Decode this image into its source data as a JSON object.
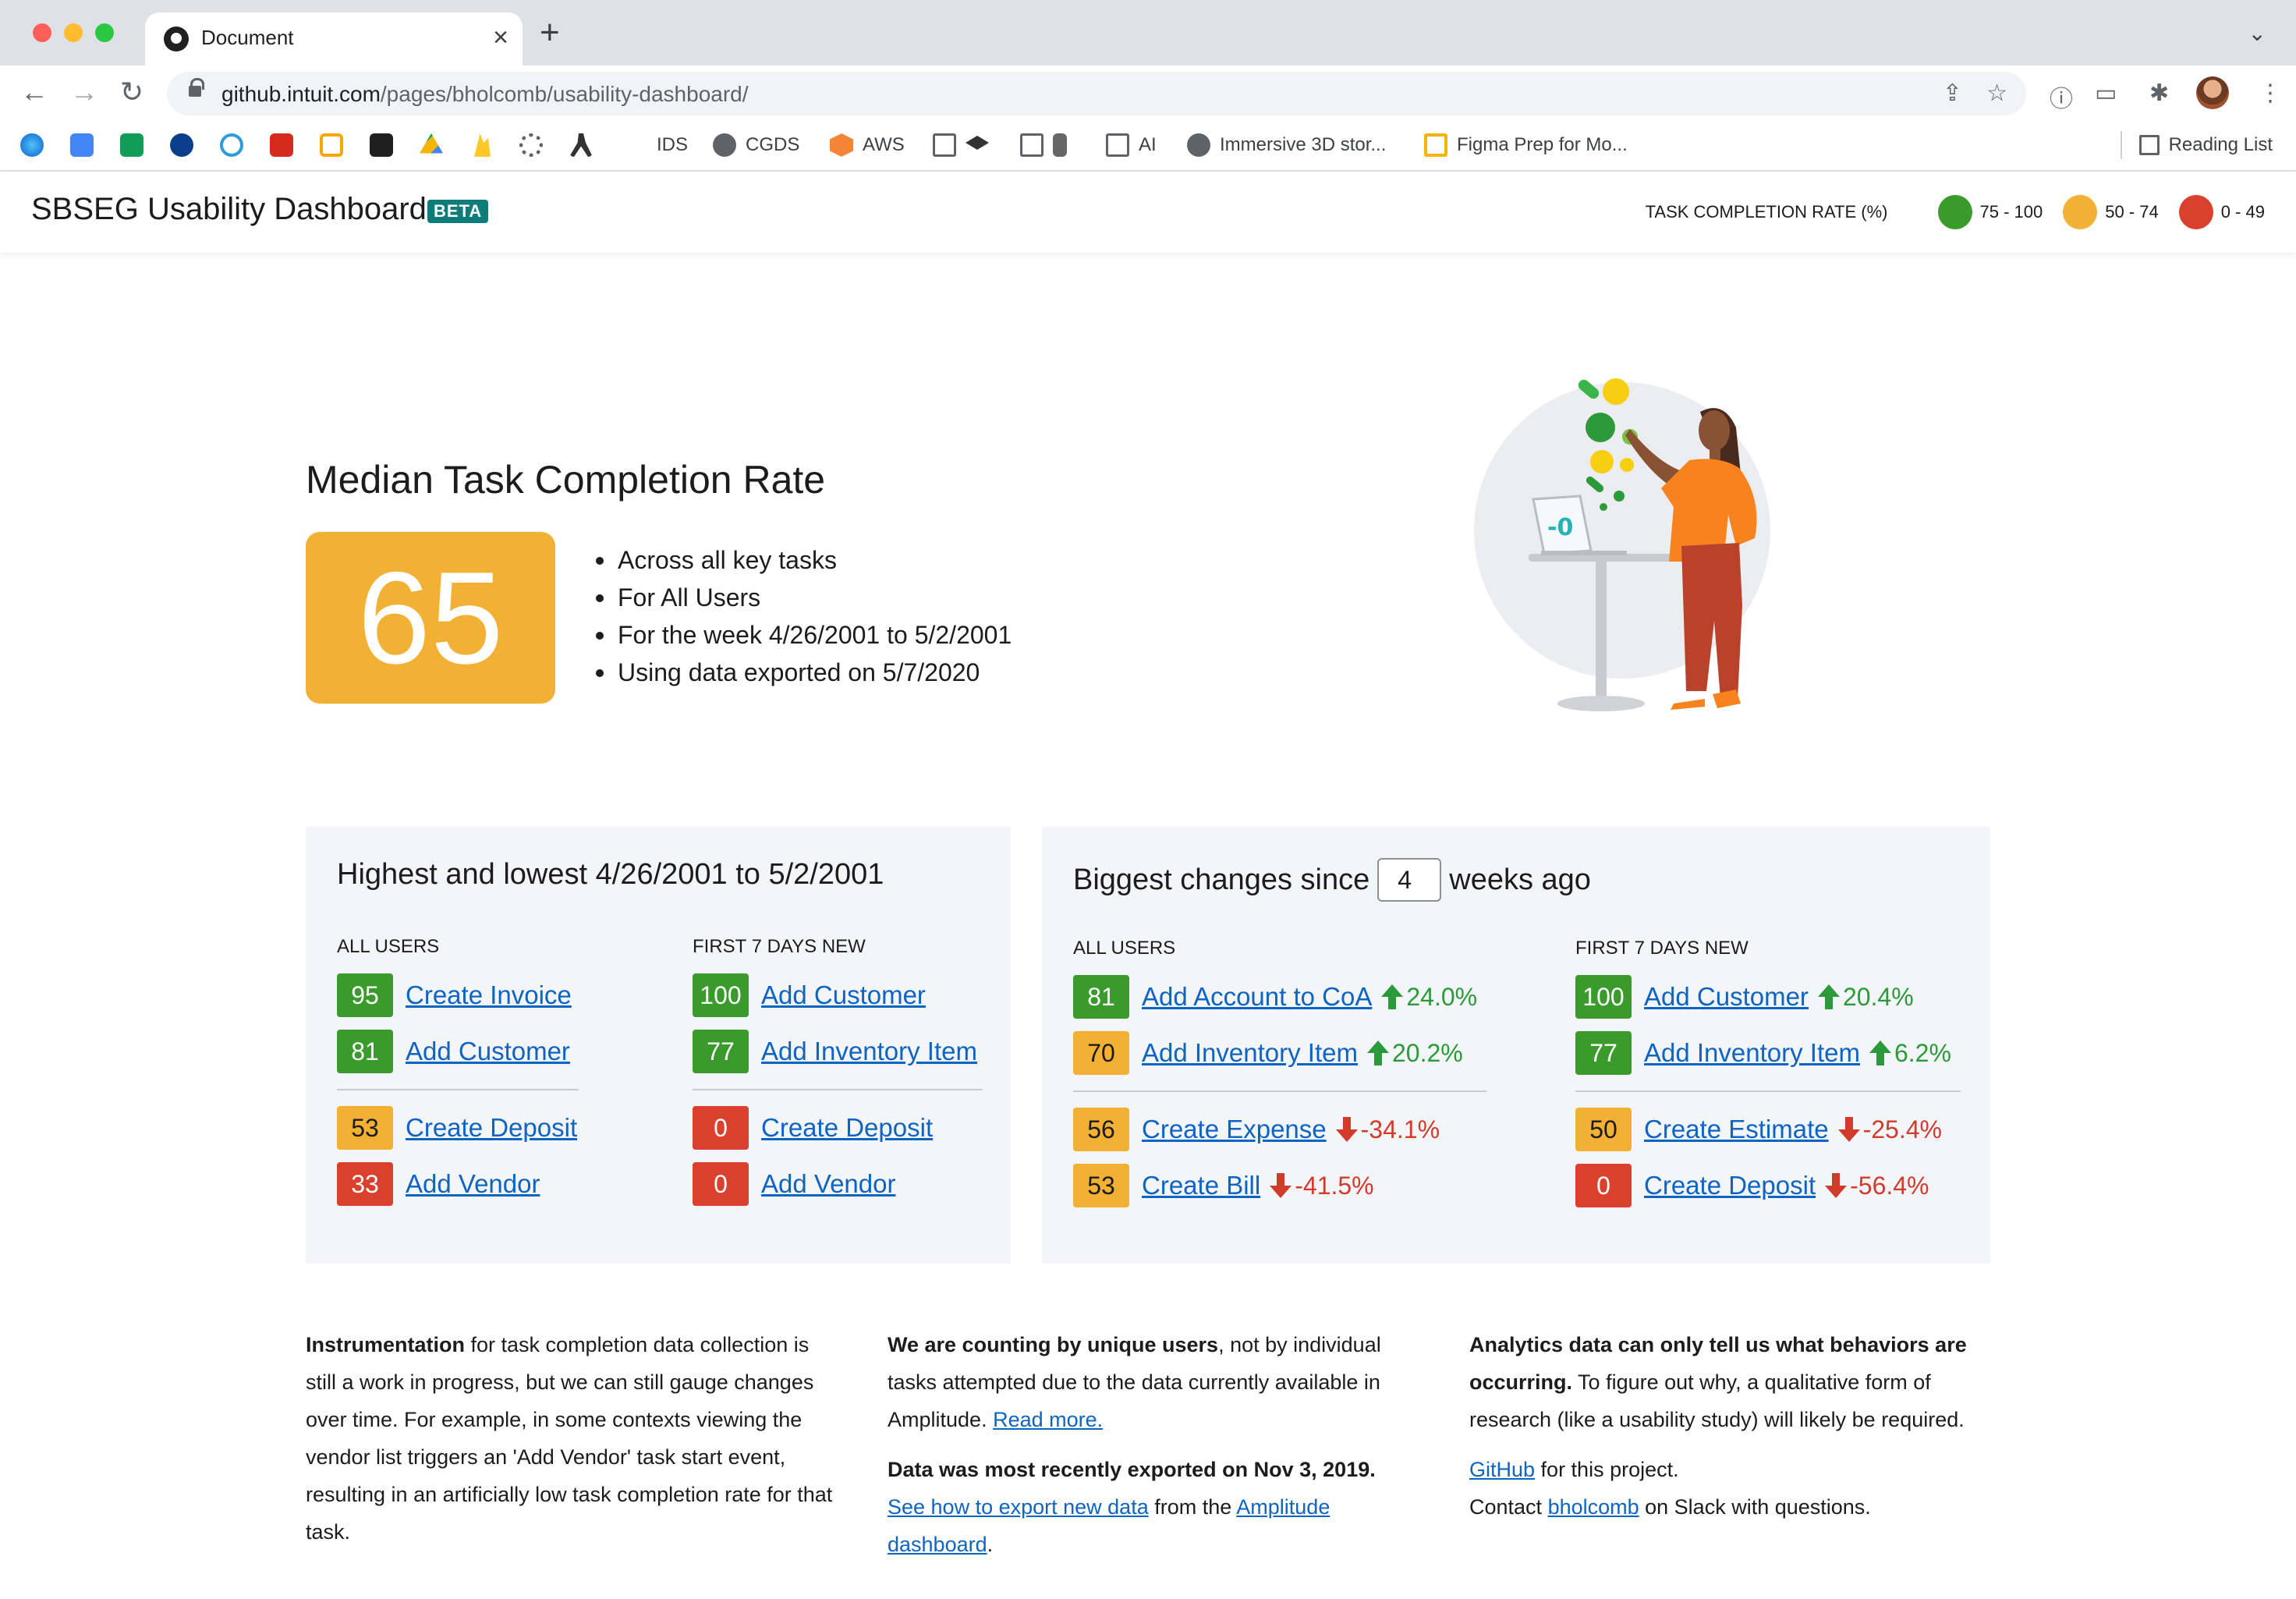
{
  "browser": {
    "tab_title": "Document",
    "tab_close": "×",
    "new_tab": "+",
    "url_host": "github.intuit.com",
    "url_path": "/pages/bholcomb/usability-dashboard/",
    "bookmarks": [
      {
        "label": "IDS",
        "icon": "text-only",
        "color": "#000000"
      },
      {
        "label": "CGDS",
        "icon": "globe-icon",
        "color": "#5f6368"
      },
      {
        "label": "AWS",
        "icon": "cube-icon",
        "color": "#f58534"
      },
      {
        "label": "",
        "icon": "folder-icon",
        "color": "#5f6368"
      },
      {
        "label": "",
        "icon": "folder-icon",
        "color": "#5f6368"
      },
      {
        "label": "AI",
        "icon": "folder-icon",
        "color": "#5f6368"
      },
      {
        "label": "Immersive 3D stor...",
        "icon": "globe-icon",
        "color": "#5f6368"
      },
      {
        "label": "Figma Prep for Mo...",
        "icon": "slides-icon",
        "color": "#f4b400"
      }
    ],
    "reading_list": "Reading List"
  },
  "header": {
    "title": "SBSEG Usability Dashboard",
    "badge": "BETA",
    "legend_title": "TASK COMPLETION RATE (%)",
    "legend": [
      {
        "range": "75 - 100",
        "color": "#3a9a2c"
      },
      {
        "range": "50 - 74",
        "color": "#f2b135"
      },
      {
        "range": "0 - 49",
        "color": "#d9402e"
      }
    ]
  },
  "hero": {
    "title": "Median Task Completion Rate",
    "score": "65",
    "bullets": [
      "Across all key tasks",
      "For All Users",
      "For the week 4/26/2001 to 5/2/2001",
      "Using data exported on 5/7/2020"
    ]
  },
  "highest_lowest": {
    "title": "Highest and lowest 4/26/2001 to 5/2/2001",
    "all_users": {
      "heading": "ALL USERS",
      "top": [
        {
          "score": "95",
          "task": "Create Invoice",
          "color": "#3a9a2c"
        },
        {
          "score": "81",
          "task": "Add Customer",
          "color": "#3a9a2c"
        }
      ],
      "bottom": [
        {
          "score": "53",
          "task": "Create Deposit",
          "color": "#f2b135"
        },
        {
          "score": "33",
          "task": "Add Vendor",
          "color": "#d9402e"
        }
      ]
    },
    "first_7_days": {
      "heading": "FIRST 7 DAYS NEW",
      "top": [
        {
          "score": "100",
          "task": "Add Customer",
          "color": "#3a9a2c"
        },
        {
          "score": "77",
          "task": "Add Inventory Item",
          "color": "#3a9a2c"
        }
      ],
      "bottom": [
        {
          "score": "0",
          "task": "Create Deposit",
          "color": "#d9402e"
        },
        {
          "score": "0",
          "task": "Add Vendor",
          "color": "#d9402e"
        }
      ]
    }
  },
  "biggest_changes": {
    "title_prefix": "Biggest changes since",
    "weeks": "4",
    "title_suffix": "weeks ago",
    "all_users": {
      "heading": "ALL USERS",
      "top": [
        {
          "score": "81",
          "task": "Add Account to CoA",
          "delta": "24.0%",
          "color": "#3a9a2c"
        },
        {
          "score": "70",
          "task": "Add Inventory Item",
          "delta": "20.2%",
          "color": "#f2b135"
        }
      ],
      "bottom": [
        {
          "score": "56",
          "task": "Create Expense",
          "delta": "-34.1%",
          "color": "#f2b135"
        },
        {
          "score": "53",
          "task": "Create Bill",
          "delta": "-41.5%",
          "color": "#f2b135"
        }
      ]
    },
    "first_7_days": {
      "heading": "FIRST 7 DAYS NEW",
      "top": [
        {
          "score": "100",
          "task": "Add Customer",
          "delta": "20.4%",
          "color": "#3a9a2c"
        },
        {
          "score": "77",
          "task": "Add Inventory Item",
          "delta": "6.2%",
          "color": "#3a9a2c"
        }
      ],
      "bottom": [
        {
          "score": "50",
          "task": "Create Estimate",
          "delta": "-25.4%",
          "color": "#f2b135"
        },
        {
          "score": "0",
          "task": "Create Deposit",
          "delta": "-56.4%",
          "color": "#d9402e"
        }
      ]
    }
  },
  "footer": {
    "col1": {
      "bold": "Instrumentation",
      "text": " for task completion data collection is still a work in progress, but we can still gauge changes over time. For example, in some contexts viewing the vendor list triggers an 'Add Vendor' task start event, resulting in an artificially low task completion rate for that task."
    },
    "col2": {
      "bold": "We are counting by unique users",
      "text": ", not by individual tasks attempted due to the data currently available in Amplitude. ",
      "link": "Read more.",
      "bold2": "Data was most recently exported on Nov 3, 2019.",
      "link2": "See how to export new data",
      "text2": " from the ",
      "link3": "Amplitude dashboard",
      "text3": "."
    },
    "col3": {
      "bold": "Analytics data can only tell us what behaviors are occurring.",
      "text": " To figure out why, a qualitative form of research (like a usability study) will likely be required.",
      "link": "GitHub",
      "text2": " for this project.",
      "text3": "Contact ",
      "link2": "bholcomb",
      "text4": " on Slack with questions."
    }
  }
}
